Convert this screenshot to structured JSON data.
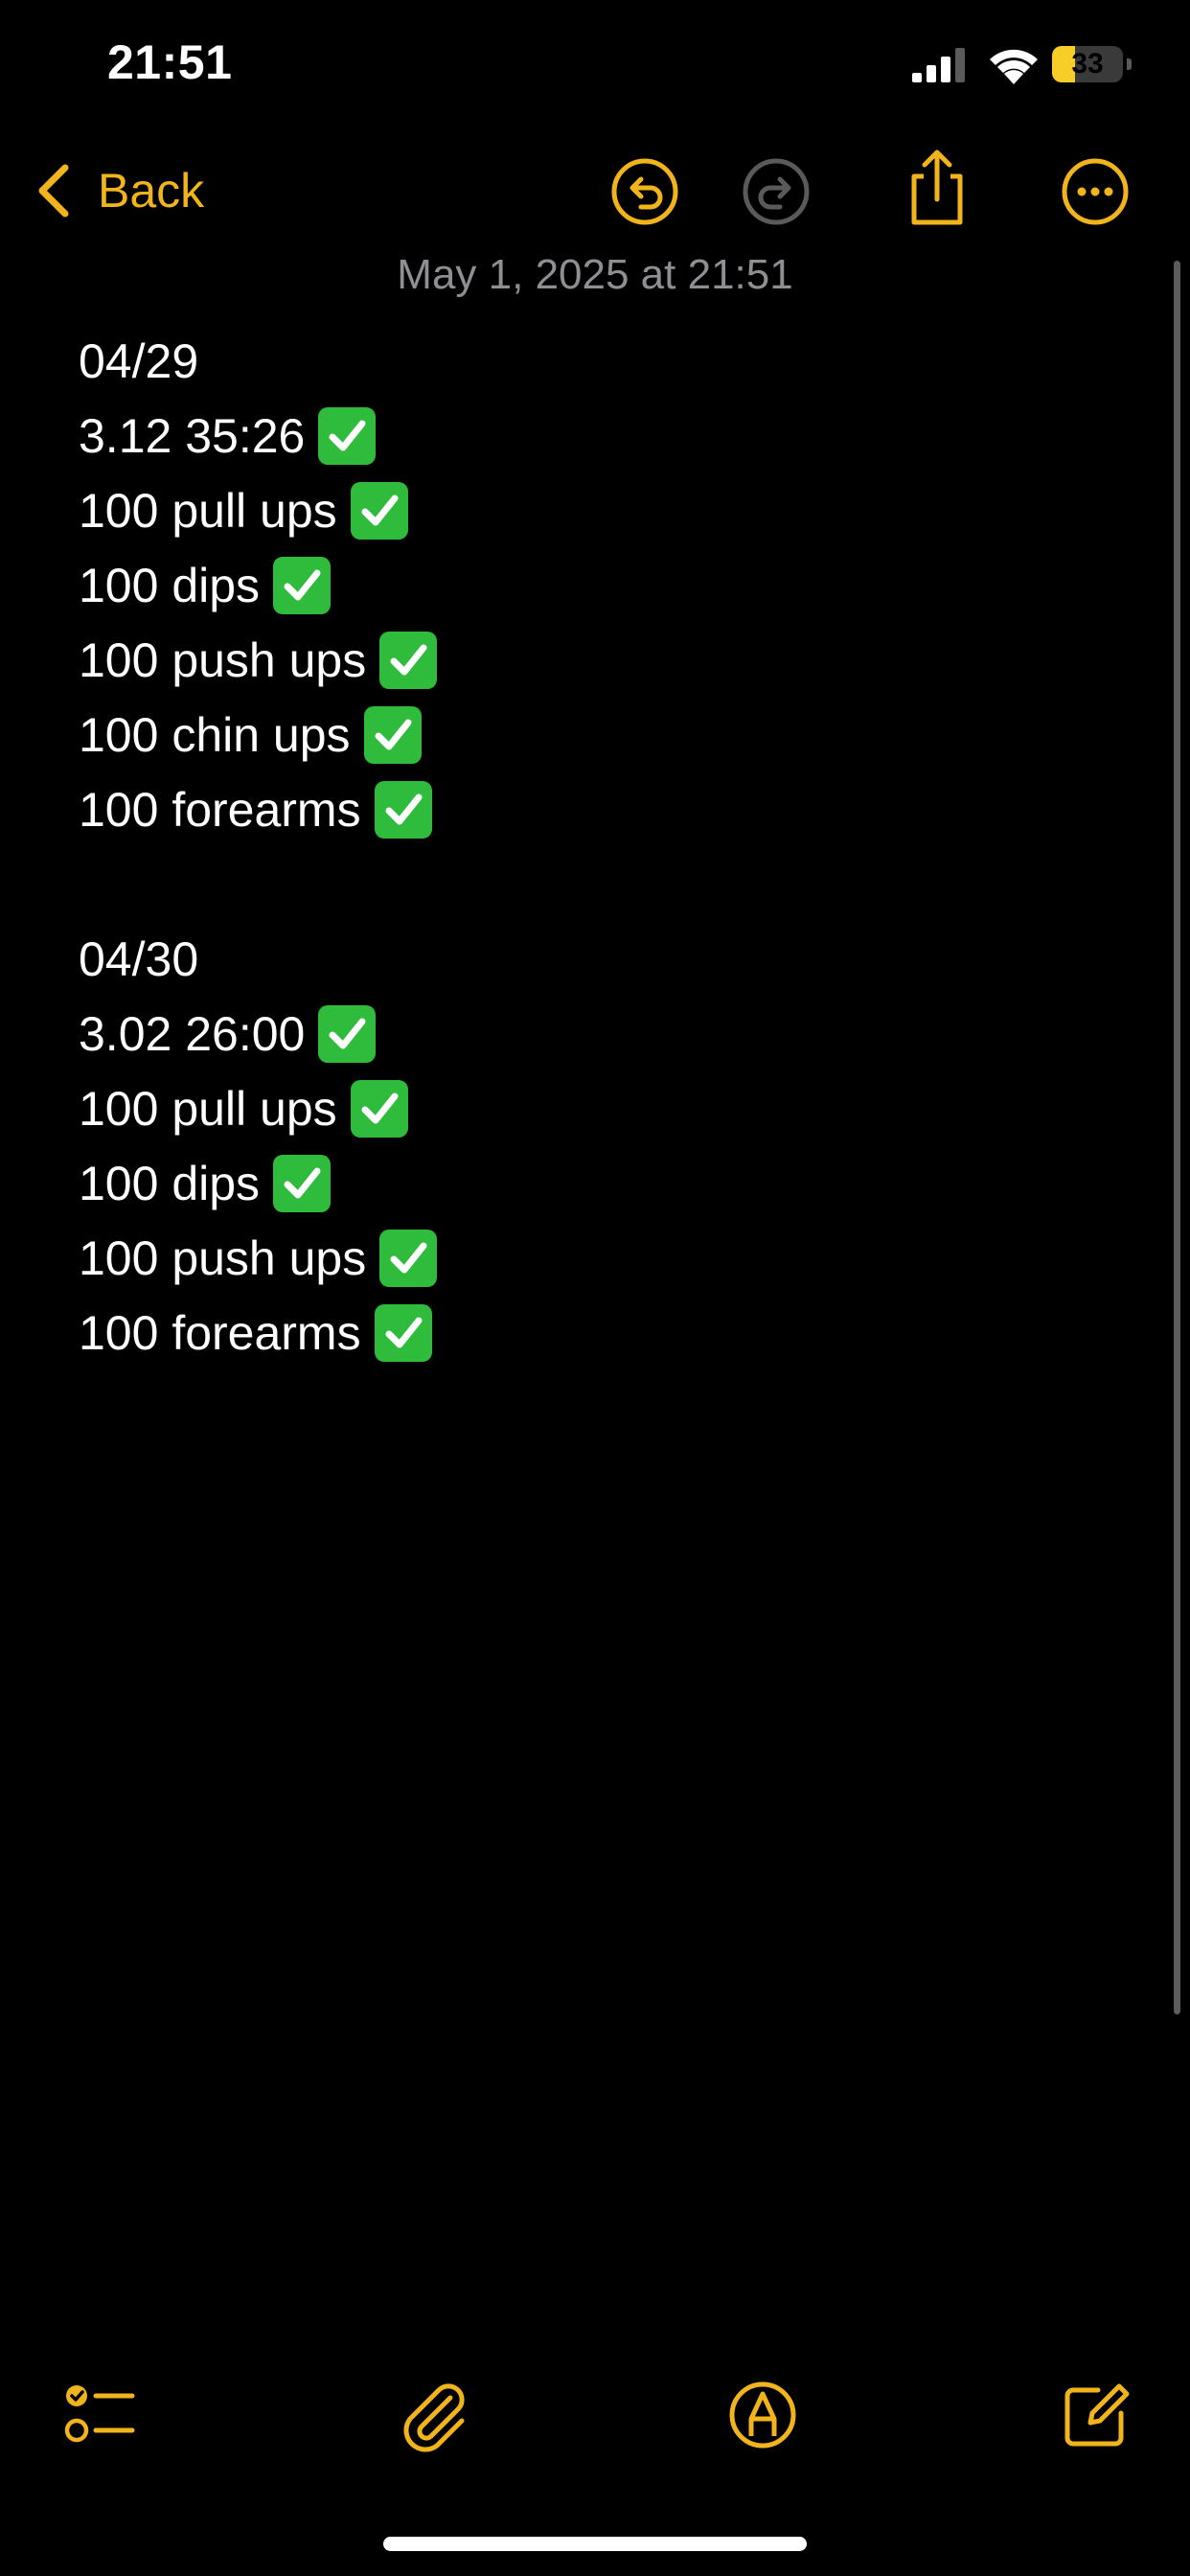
{
  "status_bar": {
    "time": "21:51",
    "battery_level": "33",
    "battery_percent": 33
  },
  "nav": {
    "back_label": "Back",
    "icons": [
      "chevron-left-icon",
      "undo-icon",
      "redo-icon",
      "share-icon",
      "more-icon"
    ]
  },
  "note": {
    "date": "May 1, 2025 at 21:51",
    "lines": [
      {
        "text": "04/29",
        "checked": false
      },
      {
        "text": "3.12 35:26",
        "checked": true
      },
      {
        "text": "100 pull ups",
        "checked": true
      },
      {
        "text": "100 dips",
        "checked": true
      },
      {
        "text": "100 push ups",
        "checked": true
      },
      {
        "text": "100 chin ups",
        "checked": true
      },
      {
        "text": "100 forearms",
        "checked": true
      },
      {
        "text": "",
        "checked": false
      },
      {
        "text": "04/30",
        "checked": false
      },
      {
        "text": "3.02 26:00",
        "checked": true
      },
      {
        "text": "100 pull ups",
        "checked": true
      },
      {
        "text": "100 dips",
        "checked": true
      },
      {
        "text": "100 push ups",
        "checked": true
      },
      {
        "text": "100 forearms",
        "checked": true
      }
    ]
  },
  "toolbar": {
    "icons": [
      "checklist-icon",
      "paperclip-icon",
      "markup-pen-icon",
      "compose-icon"
    ]
  },
  "colors": {
    "accent": "#f2b41b",
    "background": "#000000",
    "check_green": "#2fbb3c",
    "date_gray": "#8e8e93",
    "disabled_icon": "#5a5a5a"
  }
}
